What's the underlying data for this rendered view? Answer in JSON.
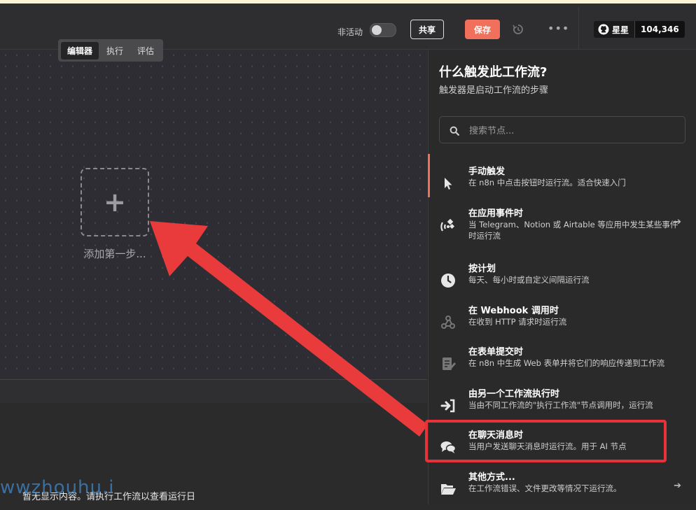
{
  "header": {
    "active_toggle_label": "非活动",
    "share_label": "共享",
    "save_label": "保存",
    "more_label": "•••",
    "github_label": "星星",
    "github_count": "104,346"
  },
  "tabs": [
    "编辑器",
    "执行",
    "评估"
  ],
  "canvas": {
    "add_first_step": "添加第一步..."
  },
  "logs": {
    "empty_text": "暂无显示内容。请执行工作流以查看运行日"
  },
  "watermark": "wwzhouhu.i",
  "panel": {
    "title": "什么触发此工作流?",
    "subtitle": "触发器是启动工作流的步骤",
    "search_placeholder": "搜索节点...",
    "items": [
      {
        "title": "手动触发",
        "desc": "在 n8n 中点击按钮时运行流。适合快速入门",
        "icon": "cursor-icon"
      },
      {
        "title": "在应用事件时",
        "desc": "当 Telegram、Notion 或 Airtable 等应用中发生某些事件时运行流",
        "icon": "satellite-icon",
        "has_arrow": true
      },
      {
        "title": "按计划",
        "desc": "每天、每小时或自定义间隔运行流",
        "icon": "clock-icon"
      },
      {
        "title": "在 Webhook 调用时",
        "desc": "在收到 HTTP 请求时运行流",
        "icon": "webhook-icon"
      },
      {
        "title": "在表单提交时",
        "desc": "在 n8n 中生成 Web 表单并将它们的响应传递到工作流",
        "icon": "form-icon"
      },
      {
        "title": "由另一个工作流执行时",
        "desc": "当由不同工作流的\"执行工作流\"节点调用时，运行流",
        "icon": "sign-in-icon"
      },
      {
        "title": "在聊天消息时",
        "desc": "当用户发送聊天消息时运行流。用于 AI 节点",
        "icon": "comments-icon"
      },
      {
        "title": "其他方式...",
        "desc": "在工作流错误、文件更改等情况下运行流。",
        "icon": "folder-open-icon",
        "has_arrow": true
      }
    ]
  },
  "colors": {
    "accent": "#f0705c",
    "annotation_red": "#e8323a"
  }
}
